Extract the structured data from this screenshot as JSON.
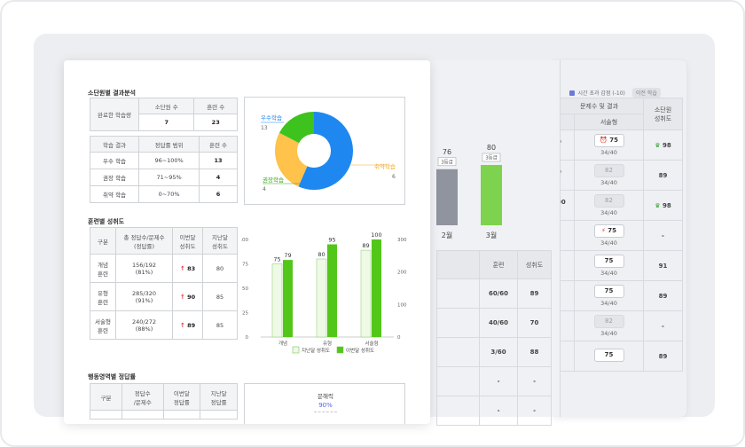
{
  "report": {
    "sec1_title": "소단원별 결과분석",
    "summary": {
      "row_label": "완료한 학습량",
      "col1": "소단원 수",
      "col2": "훈련 수",
      "val1": "7",
      "val2": "23"
    },
    "grades": {
      "headers": [
        "학습 결과",
        "정답률 범위",
        "훈련 수"
      ],
      "rows": [
        {
          "label": "우수 학습",
          "range": "96~100%",
          "count": "13"
        },
        {
          "label": "권장 학습",
          "range": "71~95%",
          "count": "4"
        },
        {
          "label": "취약 학습",
          "range": "0~70%",
          "count": "6"
        }
      ]
    },
    "pie": {
      "slices": [
        {
          "name": "우수학습",
          "value": 13,
          "color": "#1e88f0"
        },
        {
          "name": "취약학습",
          "value": 6,
          "color": "#ffc24a"
        },
        {
          "name": "권장학습",
          "value": 4,
          "color": "#3ec21e"
        }
      ],
      "labels": {
        "excellent": "우수학습",
        "excellent_val": "13",
        "weak": "취약학습",
        "weak_val": "6",
        "recommended": "권장학습",
        "recommended_val": "4"
      }
    },
    "sec2_title": "훈련별 성취도",
    "training": {
      "headers": [
        "구분",
        "총 정답수/문제수\n(정답률)",
        "이번달\n성취도",
        "지난달\n성취도"
      ],
      "rows": [
        {
          "type1": "개념",
          "type2": "훈련",
          "score": "156/192",
          "rate": "(81%)",
          "this": "83",
          "last": "80"
        },
        {
          "type1": "유형",
          "type2": "훈련",
          "score": "285/320",
          "rate": "(91%)",
          "this": "90",
          "last": "85"
        },
        {
          "type1": "서술형",
          "type2": "훈련",
          "score": "240/272",
          "rate": "(88%)",
          "this": "89",
          "last": "85"
        }
      ]
    },
    "sec3_title": "행동영역별 정답률",
    "behavior": {
      "headers": [
        "구분",
        "정답수\n/문제수",
        "이번달\n정답률",
        "지난달\n정답률"
      ]
    },
    "radar": {
      "label": "문해력",
      "value": "90%"
    }
  },
  "chart_data": [
    {
      "type": "bar",
      "categories": [
        "개념",
        "유형",
        "서술형"
      ],
      "series": [
        {
          "name": "지난달 성취도",
          "values": [
            75,
            80,
            89
          ],
          "color": "#eef9e6"
        },
        {
          "name": "이번달 성취도",
          "values": [
            79,
            95,
            100
          ],
          "color": "#52c71a"
        }
      ],
      "ylim": [
        0,
        100
      ],
      "yticks_left": [
        "100",
        "75",
        "50",
        "25",
        "0"
      ],
      "yticks_right": [
        "300",
        "200",
        "100",
        "0"
      ],
      "legend": "bottom"
    },
    {
      "type": "bar",
      "categories": [
        "2월",
        "3월"
      ],
      "values": [
        76,
        80
      ],
      "badges": [
        "3등급",
        "3등급"
      ],
      "colors": [
        "#8f949e",
        "#7ed34e"
      ]
    }
  ],
  "back": {
    "legend_frag": "억",
    "legend_clock": "시간 초과 감점 (-10)",
    "legend_prev": "이전 학습",
    "head_left": "문제수 및 결과",
    "head_sub": "서술형",
    "head_right": "소단원\n성취도",
    "rows": [
      {
        "left": "0",
        "box": "75",
        "boxgrey": false,
        "icon": "clk",
        "sub": "34/40",
        "right": "98",
        "crown": true,
        "sleft": "0"
      },
      {
        "left": "0",
        "box": "82",
        "boxgrey": true,
        "icon": "",
        "sub": "34/40",
        "right": "89",
        "crown": false,
        "sleft": "0"
      },
      {
        "left": "00",
        "box": "82",
        "boxgrey": true,
        "icon": "",
        "sub": "34/40",
        "right": "98",
        "crown": true,
        "sleft": "0"
      },
      {
        "left": "",
        "box": "75",
        "boxgrey": false,
        "icon": "bolt",
        "sub": "34/40",
        "right": "-",
        "crown": false,
        "sleft": "0"
      },
      {
        "left": "",
        "box": "75",
        "boxgrey": false,
        "icon": "",
        "sub": "34/40",
        "right": "91",
        "crown": false,
        "sleft": "0"
      },
      {
        "left": "",
        "box": "75",
        "boxgrey": false,
        "icon": "",
        "sub": "34/40",
        "right": "89",
        "crown": false,
        "sleft": "0"
      },
      {
        "left": "",
        "box": "82",
        "boxgrey": true,
        "icon": "",
        "sub": "34/40",
        "right": "-",
        "crown": false,
        "sleft": "0"
      },
      {
        "left": "",
        "box": "75",
        "boxgrey": false,
        "icon": "",
        "sub": "",
        "right": "89",
        "crown": false,
        "sleft": ""
      }
    ]
  },
  "mid": {
    "table_headers": [
      "훈련",
      "성취도"
    ],
    "rows": [
      {
        "train": "60/60",
        "ach": "89"
      },
      {
        "train": "40/60",
        "ach": "70"
      },
      {
        "train": "3/60",
        "ach": "88"
      },
      {
        "train": "-",
        "ach": "-"
      },
      {
        "train": "-",
        "ach": "-"
      }
    ]
  }
}
